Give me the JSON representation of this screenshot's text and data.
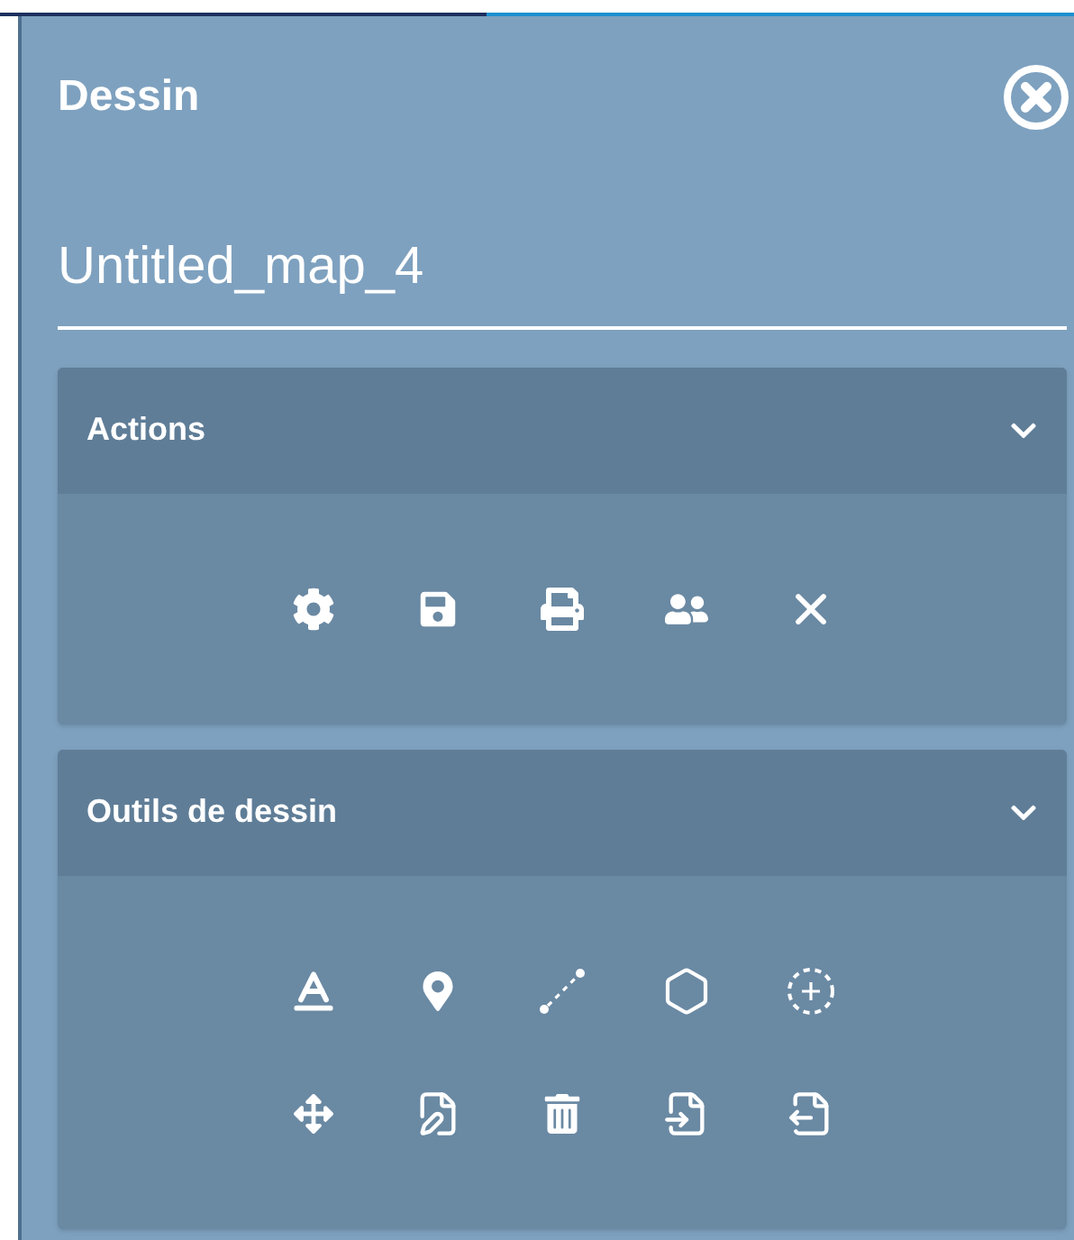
{
  "panel": {
    "title": "Dessin"
  },
  "map_name": {
    "value": "Untitled_map_4"
  },
  "sections": [
    {
      "title": "Actions",
      "expanded": true
    },
    {
      "title": "Outils de dessin",
      "expanded": true
    }
  ]
}
